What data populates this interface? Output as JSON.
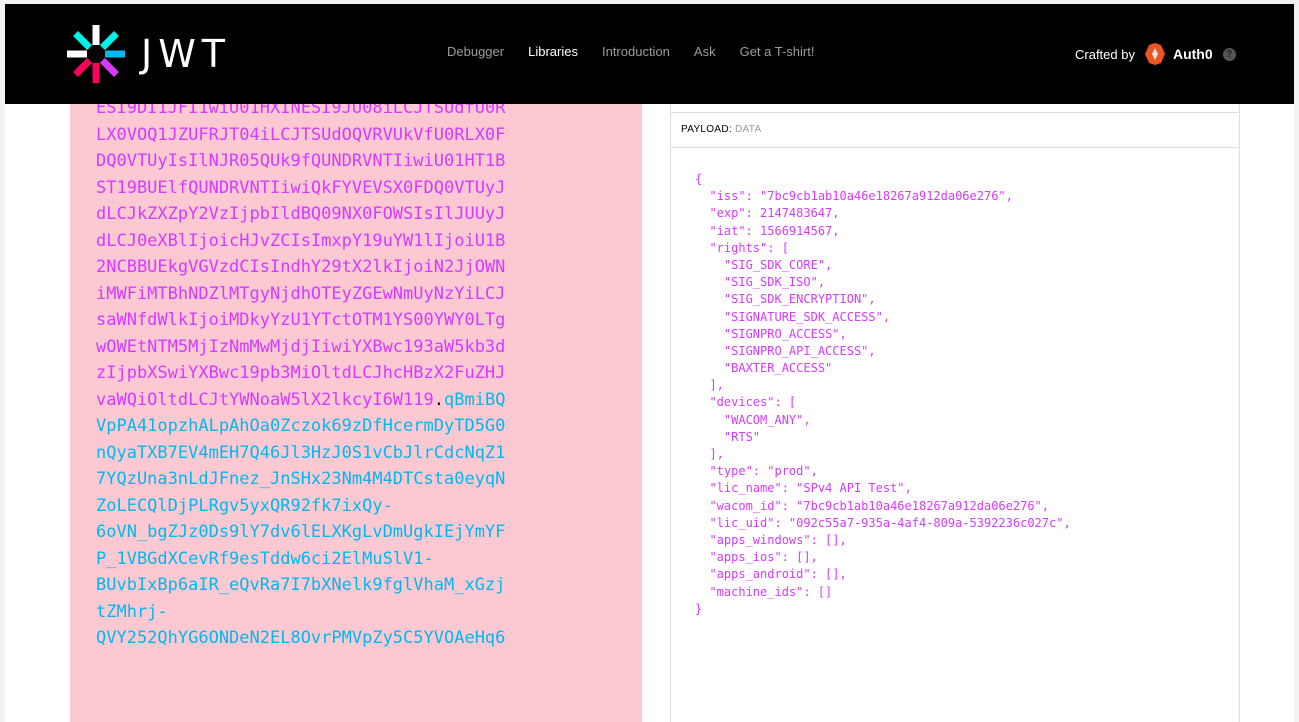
{
  "header": {
    "logo_text": "JWT",
    "nav": [
      "Debugger",
      "Libraries",
      "Introduction",
      "Ask",
      "Get a T-shirt!"
    ],
    "active_nav": "Libraries",
    "crafted_by": "Crafted by",
    "brand_name": "Auth0"
  },
  "encoded": {
    "lines": [
      {
        "pink": "ESI9DI1JFI1wiU01HXINESI9JU08iLCJTSUdfU0R",
        "dot": "",
        "cyan": ""
      },
      {
        "pink": "LX0VOQ1JZUFRJT04iLCJTSUdOQVRVUkVfU0RLX0F",
        "dot": "",
        "cyan": ""
      },
      {
        "pink": "DQ0VTUyIsIlNJR05QUk9fQUNDRVNTIiwiU01HT1B",
        "dot": "",
        "cyan": ""
      },
      {
        "pink": "ST19BUElfQUNDRVNTIiwiQkFYVEVSX0FDQ0VTUyJ",
        "dot": "",
        "cyan": ""
      },
      {
        "pink": "dLCJkZXZpY2VzIjpbIldBQ09NX0FOWSIsIlJUUyJ",
        "dot": "",
        "cyan": ""
      },
      {
        "pink": "dLCJ0eXBlIjoicHJvZCIsImxpY19uYW1lIjoiU1B",
        "dot": "",
        "cyan": ""
      },
      {
        "pink": "2NCBBUEkgVGVzdCIsIndhY29tX2lkIjoiN2JjOWN",
        "dot": "",
        "cyan": ""
      },
      {
        "pink": "iMWFiMTBhNDZlMTgyNjdhOTEyZGEwNmUyNzYiLCJ",
        "dot": "",
        "cyan": ""
      },
      {
        "pink": "saWNfdWlkIjoiMDkyYzU1YTctOTM1YS00YWY0LTg",
        "dot": "",
        "cyan": ""
      },
      {
        "pink": "wOWEtNTM5MjIzNmMwMjdjIiwiYXBwc193aW5kb3d",
        "dot": "",
        "cyan": ""
      },
      {
        "pink": "zIjpbXSwiYXBwc19pb3MiOltdLCJhcHBzX2FuZHJ",
        "dot": "",
        "cyan": ""
      },
      {
        "pink": "vaWQiOltdLCJtYWNoaW5lX2lkcyI6W119",
        "dot": ".",
        "cyan": "qBmiBQ"
      },
      {
        "pink": "",
        "dot": "",
        "cyan": "VpPA41opzhALpAhOa0Zczok69zDfHcermDyTD5G0"
      },
      {
        "pink": "",
        "dot": "",
        "cyan": "nQyaTXB7EV4mEH7Q46Jl3HzJ0S1vCbJlrCdcNqZ1"
      },
      {
        "pink": "",
        "dot": "",
        "cyan": "7YQzUna3nLdJFnez_JnSHx23Nm4M4DTCsta0eyqN"
      },
      {
        "pink": "",
        "dot": "",
        "cyan": "ZoLECQlDjPLRgv5yxQR92fk7ixQy-"
      },
      {
        "pink": "",
        "dot": "",
        "cyan": "6oVN_bgZJz0Ds9lY7dv6lELXKgLvDmUgkIEjYmYF"
      },
      {
        "pink": "",
        "dot": "",
        "cyan": "P_1VBGdXCevRf9esTddw6ci2ElMuSlV1-"
      },
      {
        "pink": "",
        "dot": "",
        "cyan": "BUvbIxBp6aIR_eQvRa7I7bXNelk9fglVhaM_xGzj"
      },
      {
        "pink": "",
        "dot": "",
        "cyan": "tZMhrj-"
      },
      {
        "pink": "",
        "dot": "",
        "cyan": "QVY252QhYG6ONDeN2EL8OvrPMVpZy5C5YVOAeHq6"
      }
    ]
  },
  "payload": {
    "label": "PAYLOAD:",
    "sublabel": "DATA",
    "lines": [
      "{",
      "  \"iss\": \"7bc9cb1ab10a46e18267a912da06e276\",",
      "  \"exp\": 2147483647,",
      "  \"iat\": 1566914567,",
      "  \"rights\": [",
      "    \"SIG_SDK_CORE\",",
      "    \"SIG_SDK_ISO\",",
      "    \"SIG_SDK_ENCRYPTION\",",
      "    \"SIGNATURE_SDK_ACCESS\",",
      "    \"SIGNPRO_ACCESS\",",
      "    \"SIGNPRO_API_ACCESS\",",
      "    \"BAXTER_ACCESS\"",
      "  ],",
      "  \"devices\": [",
      "    \"WACOM_ANY\",",
      "    \"RTS\"",
      "  ],",
      "  \"type\": \"prod\",",
      "  \"lic_name\": \"SPv4 API Test\",",
      "  \"wacom_id\": \"7bc9cb1ab10a46e18267a912da06e276\",",
      "  \"lic_uid\": \"092c55a7-935a-4af4-809a-5392236c027c\",",
      "  \"apps_windows\": [],",
      "  \"apps_ios\": [],",
      "  \"apps_android\": [],",
      "  \"machine_ids\": []",
      "}"
    ]
  },
  "colors": {
    "header_bg": "#000000",
    "encoded_bg": "#fcc8d2",
    "payload_color": "#d63aff",
    "signature_color": "#00b9f1"
  }
}
